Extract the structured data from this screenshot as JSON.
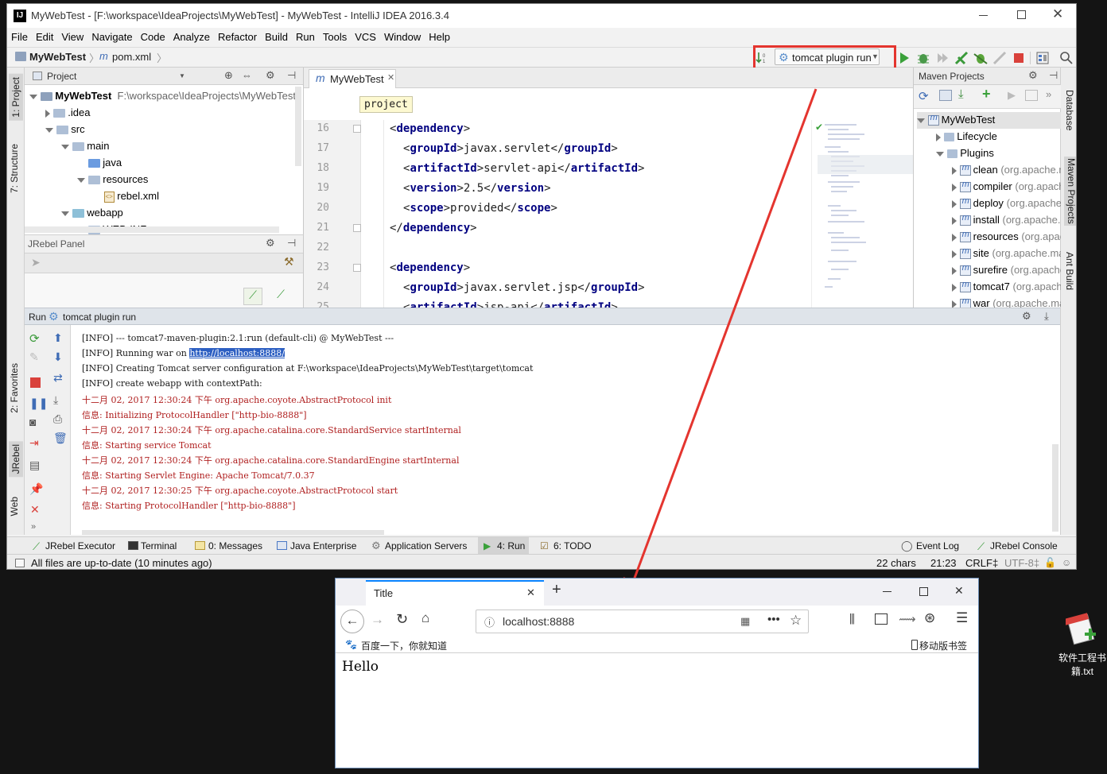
{
  "ide": {
    "title": "MyWebTest - [F:\\workspace\\IdeaProjects\\MyWebTest] - MyWebTest - IntelliJ IDEA 2016.3.4",
    "menu": [
      "File",
      "Edit",
      "View",
      "Navigate",
      "Code",
      "Analyze",
      "Refactor",
      "Build",
      "Run",
      "Tools",
      "VCS",
      "Window",
      "Help"
    ],
    "breadcrumb": {
      "project": "MyWebTest",
      "file": "pom.xml"
    },
    "run_config": "tomcat plugin run",
    "left_tabs": [
      "1: Project",
      "7: Structure",
      "2: Favorites",
      "JRebel",
      "Web"
    ],
    "right_tabs": [
      "Database",
      "Maven Projects",
      "Ant Build"
    ],
    "project_panel": {
      "title": "Project",
      "tree": [
        {
          "label": "MyWebTest",
          "path": "F:\\workspace\\IdeaProjects\\MyWebTest",
          "depth": 0,
          "open": true,
          "kind": "module"
        },
        {
          "label": ".idea",
          "depth": 1,
          "open": false,
          "kind": "folder"
        },
        {
          "label": "src",
          "depth": 1,
          "open": true,
          "kind": "folder"
        },
        {
          "label": "main",
          "depth": 2,
          "open": true,
          "kind": "folder"
        },
        {
          "label": "java",
          "depth": 3,
          "kind": "src-folder"
        },
        {
          "label": "resources",
          "depth": 3,
          "open": true,
          "kind": "res-folder"
        },
        {
          "label": "rebel.xml",
          "depth": 4,
          "kind": "xml"
        },
        {
          "label": "webapp",
          "depth": 2,
          "open": true,
          "kind": "web-folder"
        },
        {
          "label": "WEB-INF",
          "depth": 3,
          "open": true,
          "kind": "folder"
        }
      ]
    },
    "jrebel_panel": {
      "title": "JRebel Panel"
    },
    "editor": {
      "tab": "MyWebTest",
      "breadcrumb_tip": "project",
      "lines": [
        {
          "n": "16",
          "indent": 0,
          "tag": "dependency",
          "type": "open"
        },
        {
          "n": "17",
          "indent": 1,
          "tag": "groupId",
          "value": "javax.servlet"
        },
        {
          "n": "18",
          "indent": 1,
          "tag": "artifactId",
          "value": "servlet-api"
        },
        {
          "n": "19",
          "indent": 1,
          "tag": "version",
          "value": "2.5"
        },
        {
          "n": "20",
          "indent": 1,
          "tag": "scope",
          "value": "provided"
        },
        {
          "n": "21",
          "indent": 0,
          "tag": "dependency",
          "type": "close"
        },
        {
          "n": "22",
          "type": "blank"
        },
        {
          "n": "23",
          "indent": 0,
          "tag": "dependency",
          "type": "open"
        },
        {
          "n": "24",
          "indent": 1,
          "tag": "groupId",
          "value": "javax.servlet.jsp"
        },
        {
          "n": "25",
          "indent": 1,
          "tag": "artifactId",
          "value": "jsp-api"
        }
      ]
    },
    "maven": {
      "title": "Maven Projects",
      "root": "MyWebTest",
      "lifecycle": "Lifecycle",
      "plugins_label": "Plugins",
      "plugins": [
        {
          "name": "clean",
          "group": "(org.apache.maven.plugins)"
        },
        {
          "name": "compiler",
          "group": "(org.apache.maven.plugins)"
        },
        {
          "name": "deploy",
          "group": "(org.apache.maven.plugins)"
        },
        {
          "name": "install",
          "group": "(org.apache.maven.plugins)"
        },
        {
          "name": "resources",
          "group": "(org.apache.maven.plugins)"
        },
        {
          "name": "site",
          "group": "(org.apache.maven.plugins)"
        },
        {
          "name": "surefire",
          "group": "(org.apache.maven.plugins)"
        },
        {
          "name": "tomcat7",
          "group": "(org.apache.tomcat.maven)"
        },
        {
          "name": "war",
          "group": "(org.apache.maven.plugins)"
        }
      ]
    },
    "run": {
      "label": "Run",
      "config": "tomcat plugin run",
      "console": [
        {
          "t": "[INFO] --- tomcat7-maven-plugin:2.1:run (default-cli) @ MyWebTest ---",
          "k": "info"
        },
        {
          "t": "[INFO] Running war on ",
          "link": "http://localhost:8888/",
          "k": "info"
        },
        {
          "t": "[INFO] Creating Tomcat server configuration at F:\\workspace\\IdeaProjects\\MyWebTest\\target\\tomcat",
          "k": "info"
        },
        {
          "t": "[INFO] create webapp with contextPath:",
          "k": "info"
        },
        {
          "t": "十二月 02, 2017 12:30:24 下午 org.apache.coyote.AbstractProtocol init",
          "k": "err"
        },
        {
          "t": "信息: Initializing ProtocolHandler [\"http-bio-8888\"]",
          "k": "err"
        },
        {
          "t": "十二月 02, 2017 12:30:24 下午 org.apache.catalina.core.StandardService startInternal",
          "k": "err"
        },
        {
          "t": "信息: Starting service Tomcat",
          "k": "err"
        },
        {
          "t": "十二月 02, 2017 12:30:24 下午 org.apache.catalina.core.StandardEngine startInternal",
          "k": "err"
        },
        {
          "t": "信息: Starting Servlet Engine: Apache Tomcat/7.0.37",
          "k": "err"
        },
        {
          "t": "十二月 02, 2017 12:30:25 下午 org.apache.coyote.AbstractProtocol start",
          "k": "err"
        },
        {
          "t": "信息: Starting ProtocolHandler [\"http-bio-8888\"]",
          "k": "err"
        }
      ]
    },
    "bottom_tabs": {
      "jrebel_executor": "JRebel Executor",
      "terminal": "Terminal",
      "messages": "0: Messages",
      "java_enterprise": "Java Enterprise",
      "app_servers": "Application Servers",
      "run": "4: Run",
      "todo": "6: TODO",
      "event_log": "Event Log",
      "jrebel_console": "JRebel Console"
    },
    "status": {
      "message": "All files are up-to-date (10 minutes ago)",
      "chars": "22 chars",
      "position": "21:23",
      "line_sep": "CRLF‡",
      "encoding": "UTF-8‡"
    }
  },
  "browser": {
    "tab_title": "Title",
    "url": "localhost:8888",
    "bookmark": "百度一下，你就知道",
    "mobile_bookmarks": "移动版书签",
    "content": "Hello"
  },
  "desktop_icon": {
    "label": "软件工程书籍.txt"
  },
  "colors": {
    "highlight": "#e4352f",
    "tag": "#000080",
    "console_red": "#b02020",
    "link_bg": "#2d5fc2"
  }
}
